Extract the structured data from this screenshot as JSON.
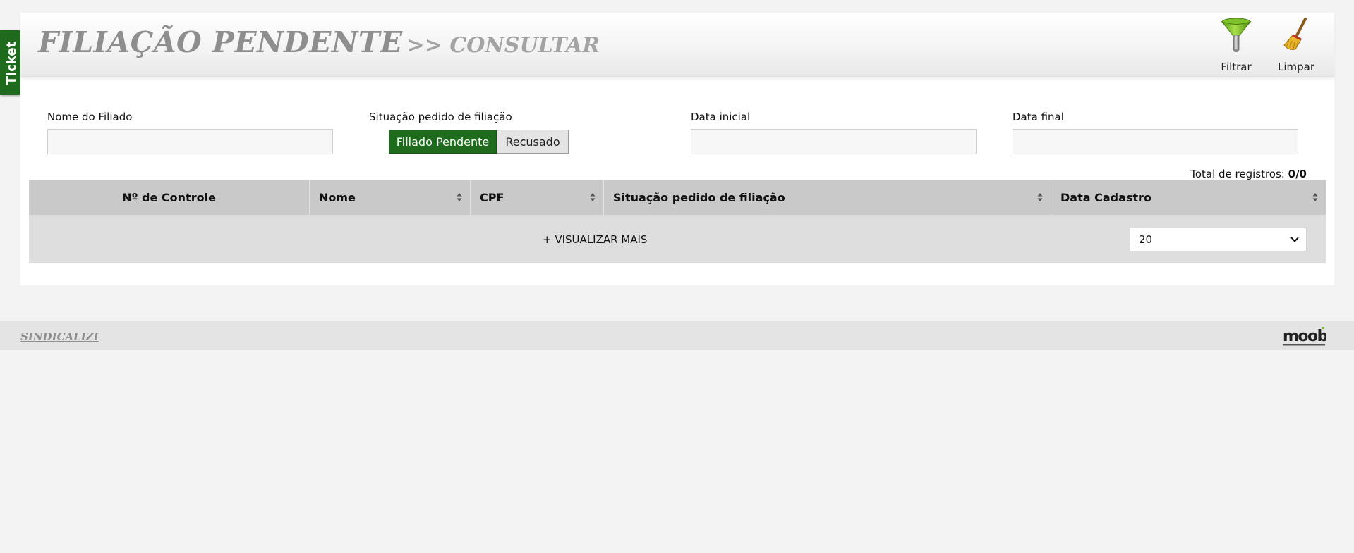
{
  "ticket_tab": {
    "label": "Ticket"
  },
  "header": {
    "title": "FILIAÇÃO PENDENTE",
    "subtitle": ">> CONSULTAR",
    "actions": [
      {
        "label": "Filtrar",
        "icon": "funnel-icon"
      },
      {
        "label": "Limpar",
        "icon": "broom-icon"
      }
    ]
  },
  "filters": {
    "nome_label": "Nome do Filiado",
    "nome_value": "",
    "situacao_label": "Situação pedido de filiação",
    "situacao_options": [
      "Filiado Pendente",
      "Recusado"
    ],
    "situacao_selected": "Filiado Pendente",
    "data_inicial_label": "Data inicial",
    "data_inicial_value": "",
    "data_final_label": "Data final",
    "data_final_value": ""
  },
  "total": {
    "label": "Total de registros:",
    "value": "0/0"
  },
  "table": {
    "columns": [
      "Nº de Controle",
      "Nome",
      "CPF",
      "Situação pedido de filiação",
      "Data Cadastro"
    ],
    "rows": [],
    "more_label": "+ VISUALIZAR MAIS",
    "page_size": "20"
  },
  "footer": {
    "brand": "SINDICALIZI",
    "logo_text": "moobi"
  },
  "colors": {
    "accent": "#1e6b1e",
    "title_gray": "#8e8e8e",
    "header_gray": "#c9c9c9"
  }
}
